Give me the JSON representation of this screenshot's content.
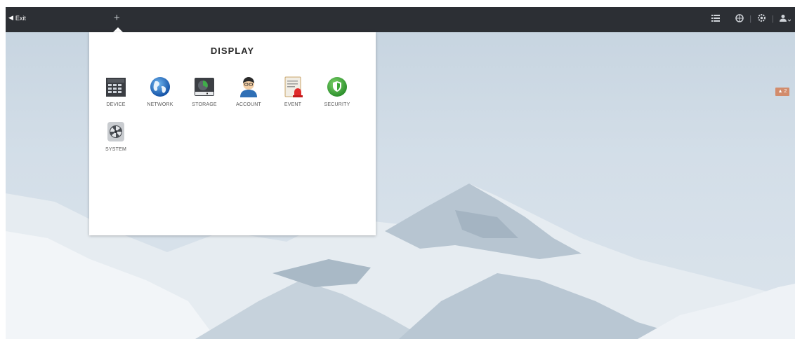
{
  "topbar": {
    "exit_label": "Exit",
    "add_tab_label": "+"
  },
  "alarm": {
    "count": "2",
    "icon": "warning-icon"
  },
  "panel": {
    "title": "DISPLAY",
    "items": [
      {
        "label": "DEVICE",
        "icon": "device-icon"
      },
      {
        "label": "NETWORK",
        "icon": "network-globe-icon"
      },
      {
        "label": "STORAGE",
        "icon": "storage-icon"
      },
      {
        "label": "ACCOUNT",
        "icon": "account-icon"
      },
      {
        "label": "EVENT",
        "icon": "event-icon"
      },
      {
        "label": "SECURITY",
        "icon": "security-shield-icon"
      },
      {
        "label": "SYSTEM",
        "icon": "system-fan-icon"
      }
    ]
  },
  "colors": {
    "topbar": "#2c2f34",
    "panel": "#ffffff",
    "security": "#3aa535",
    "network": "#1f6fc2",
    "event_red": "#e02a2a"
  }
}
